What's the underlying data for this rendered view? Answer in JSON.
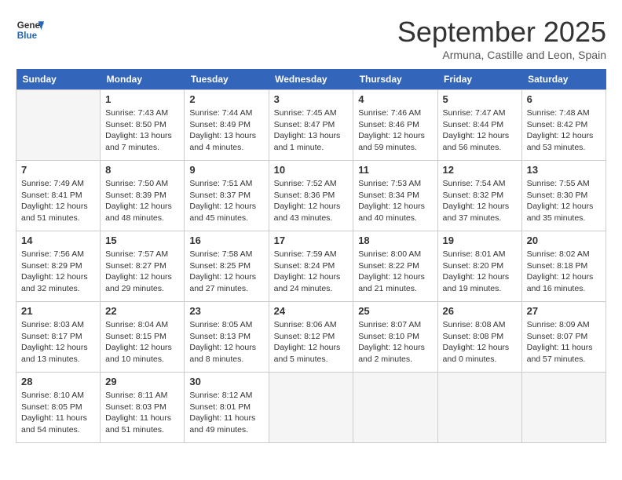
{
  "header": {
    "logo_general": "General",
    "logo_blue": "Blue",
    "month": "September 2025",
    "location": "Armuna, Castille and Leon, Spain"
  },
  "days_of_week": [
    "Sunday",
    "Monday",
    "Tuesday",
    "Wednesday",
    "Thursday",
    "Friday",
    "Saturday"
  ],
  "weeks": [
    [
      {
        "day": "",
        "content": ""
      },
      {
        "day": "1",
        "content": "Sunrise: 7:43 AM\nSunset: 8:50 PM\nDaylight: 13 hours\nand 7 minutes."
      },
      {
        "day": "2",
        "content": "Sunrise: 7:44 AM\nSunset: 8:49 PM\nDaylight: 13 hours\nand 4 minutes."
      },
      {
        "day": "3",
        "content": "Sunrise: 7:45 AM\nSunset: 8:47 PM\nDaylight: 13 hours\nand 1 minute."
      },
      {
        "day": "4",
        "content": "Sunrise: 7:46 AM\nSunset: 8:46 PM\nDaylight: 12 hours\nand 59 minutes."
      },
      {
        "day": "5",
        "content": "Sunrise: 7:47 AM\nSunset: 8:44 PM\nDaylight: 12 hours\nand 56 minutes."
      },
      {
        "day": "6",
        "content": "Sunrise: 7:48 AM\nSunset: 8:42 PM\nDaylight: 12 hours\nand 53 minutes."
      }
    ],
    [
      {
        "day": "7",
        "content": "Sunrise: 7:49 AM\nSunset: 8:41 PM\nDaylight: 12 hours\nand 51 minutes."
      },
      {
        "day": "8",
        "content": "Sunrise: 7:50 AM\nSunset: 8:39 PM\nDaylight: 12 hours\nand 48 minutes."
      },
      {
        "day": "9",
        "content": "Sunrise: 7:51 AM\nSunset: 8:37 PM\nDaylight: 12 hours\nand 45 minutes."
      },
      {
        "day": "10",
        "content": "Sunrise: 7:52 AM\nSunset: 8:36 PM\nDaylight: 12 hours\nand 43 minutes."
      },
      {
        "day": "11",
        "content": "Sunrise: 7:53 AM\nSunset: 8:34 PM\nDaylight: 12 hours\nand 40 minutes."
      },
      {
        "day": "12",
        "content": "Sunrise: 7:54 AM\nSunset: 8:32 PM\nDaylight: 12 hours\nand 37 minutes."
      },
      {
        "day": "13",
        "content": "Sunrise: 7:55 AM\nSunset: 8:30 PM\nDaylight: 12 hours\nand 35 minutes."
      }
    ],
    [
      {
        "day": "14",
        "content": "Sunrise: 7:56 AM\nSunset: 8:29 PM\nDaylight: 12 hours\nand 32 minutes."
      },
      {
        "day": "15",
        "content": "Sunrise: 7:57 AM\nSunset: 8:27 PM\nDaylight: 12 hours\nand 29 minutes."
      },
      {
        "day": "16",
        "content": "Sunrise: 7:58 AM\nSunset: 8:25 PM\nDaylight: 12 hours\nand 27 minutes."
      },
      {
        "day": "17",
        "content": "Sunrise: 7:59 AM\nSunset: 8:24 PM\nDaylight: 12 hours\nand 24 minutes."
      },
      {
        "day": "18",
        "content": "Sunrise: 8:00 AM\nSunset: 8:22 PM\nDaylight: 12 hours\nand 21 minutes."
      },
      {
        "day": "19",
        "content": "Sunrise: 8:01 AM\nSunset: 8:20 PM\nDaylight: 12 hours\nand 19 minutes."
      },
      {
        "day": "20",
        "content": "Sunrise: 8:02 AM\nSunset: 8:18 PM\nDaylight: 12 hours\nand 16 minutes."
      }
    ],
    [
      {
        "day": "21",
        "content": "Sunrise: 8:03 AM\nSunset: 8:17 PM\nDaylight: 12 hours\nand 13 minutes."
      },
      {
        "day": "22",
        "content": "Sunrise: 8:04 AM\nSunset: 8:15 PM\nDaylight: 12 hours\nand 10 minutes."
      },
      {
        "day": "23",
        "content": "Sunrise: 8:05 AM\nSunset: 8:13 PM\nDaylight: 12 hours\nand 8 minutes."
      },
      {
        "day": "24",
        "content": "Sunrise: 8:06 AM\nSunset: 8:12 PM\nDaylight: 12 hours\nand 5 minutes."
      },
      {
        "day": "25",
        "content": "Sunrise: 8:07 AM\nSunset: 8:10 PM\nDaylight: 12 hours\nand 2 minutes."
      },
      {
        "day": "26",
        "content": "Sunrise: 8:08 AM\nSunset: 8:08 PM\nDaylight: 12 hours\nand 0 minutes."
      },
      {
        "day": "27",
        "content": "Sunrise: 8:09 AM\nSunset: 8:07 PM\nDaylight: 11 hours\nand 57 minutes."
      }
    ],
    [
      {
        "day": "28",
        "content": "Sunrise: 8:10 AM\nSunset: 8:05 PM\nDaylight: 11 hours\nand 54 minutes."
      },
      {
        "day": "29",
        "content": "Sunrise: 8:11 AM\nSunset: 8:03 PM\nDaylight: 11 hours\nand 51 minutes."
      },
      {
        "day": "30",
        "content": "Sunrise: 8:12 AM\nSunset: 8:01 PM\nDaylight: 11 hours\nand 49 minutes."
      },
      {
        "day": "",
        "content": ""
      },
      {
        "day": "",
        "content": ""
      },
      {
        "day": "",
        "content": ""
      },
      {
        "day": "",
        "content": ""
      }
    ]
  ]
}
